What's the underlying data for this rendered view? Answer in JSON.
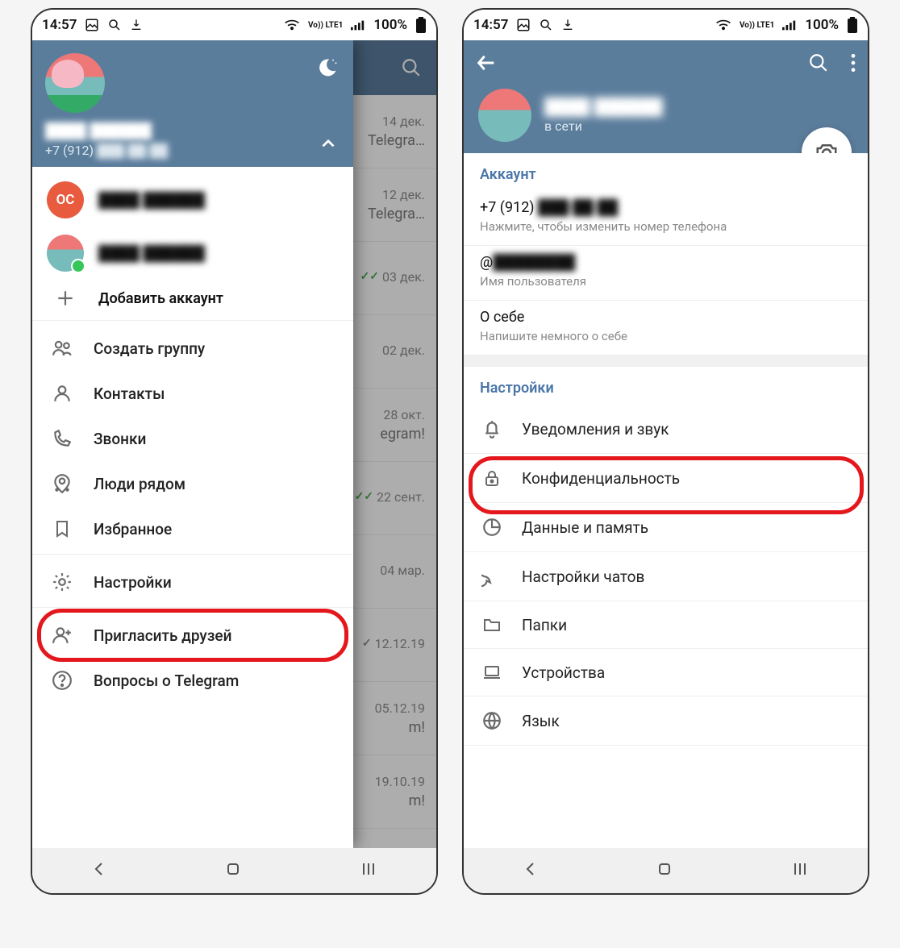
{
  "status": {
    "time": "14:57",
    "battery": "100%",
    "net_badge": "Vo)) LTE1"
  },
  "screen1": {
    "drawer": {
      "username": "████ ██████",
      "phone_prefix": "+7 (912)",
      "phone_rest": "███-██-██",
      "accounts": [
        {
          "initials": "ОС",
          "name": "████ ██████"
        },
        {
          "initials": "",
          "name": "████ ██████"
        }
      ],
      "add_account": "Добавить аккаунт",
      "menu": [
        {
          "icon": "group",
          "label": "Создать группу"
        },
        {
          "icon": "person",
          "label": "Контакты"
        },
        {
          "icon": "call",
          "label": "Звонки"
        },
        {
          "icon": "near",
          "label": "Люди рядом"
        },
        {
          "icon": "bookmark",
          "label": "Избранное"
        },
        {
          "icon": "gear",
          "label": "Настройки"
        },
        {
          "icon": "invite",
          "label": "Пригласить друзей"
        },
        {
          "icon": "help",
          "label": "Вопросы о Telegram"
        }
      ]
    },
    "chats": [
      {
        "date": "14 дек.",
        "snippet": "Telegra…",
        "ticks": ""
      },
      {
        "date": "12 дек.",
        "snippet": "Telegra…",
        "ticks": ""
      },
      {
        "date": "03 дек.",
        "snippet": "",
        "ticks": "double"
      },
      {
        "date": "02 дек.",
        "snippet": "",
        "ticks": ""
      },
      {
        "date": "28 окт.",
        "snippet": "egram!",
        "ticks": ""
      },
      {
        "date": "22 сент.",
        "snippet": "",
        "ticks": "double"
      },
      {
        "date": "04 мар.",
        "snippet": "",
        "ticks": ""
      },
      {
        "date": "12.12.19",
        "snippet": "",
        "ticks": "gray"
      },
      {
        "date": "05.12.19",
        "snippet": "m!",
        "ticks": ""
      },
      {
        "date": "19.10.19",
        "snippet": "m!",
        "ticks": ""
      }
    ]
  },
  "screen2": {
    "user": {
      "name": "████ ██████",
      "status": "в сети"
    },
    "account_section_title": "Аккаунт",
    "phone_prefix": "+7 (912)",
    "phone_rest": "███-██-██",
    "phone_hint": "Нажмите, чтобы изменить номер телефона",
    "username_prefix": "@",
    "username_value": "████████",
    "username_hint": "Имя пользователя",
    "bio_title": "О себе",
    "bio_hint": "Напишите немного о себе",
    "settings_section_title": "Настройки",
    "settings": [
      {
        "icon": "bell",
        "label": "Уведомления и звук"
      },
      {
        "icon": "lock",
        "label": "Конфиденциальность"
      },
      {
        "icon": "pie",
        "label": "Данные и память"
      },
      {
        "icon": "chat",
        "label": "Настройки чатов"
      },
      {
        "icon": "folder",
        "label": "Папки"
      },
      {
        "icon": "laptop",
        "label": "Устройства"
      },
      {
        "icon": "globe",
        "label": "Язык"
      }
    ]
  }
}
